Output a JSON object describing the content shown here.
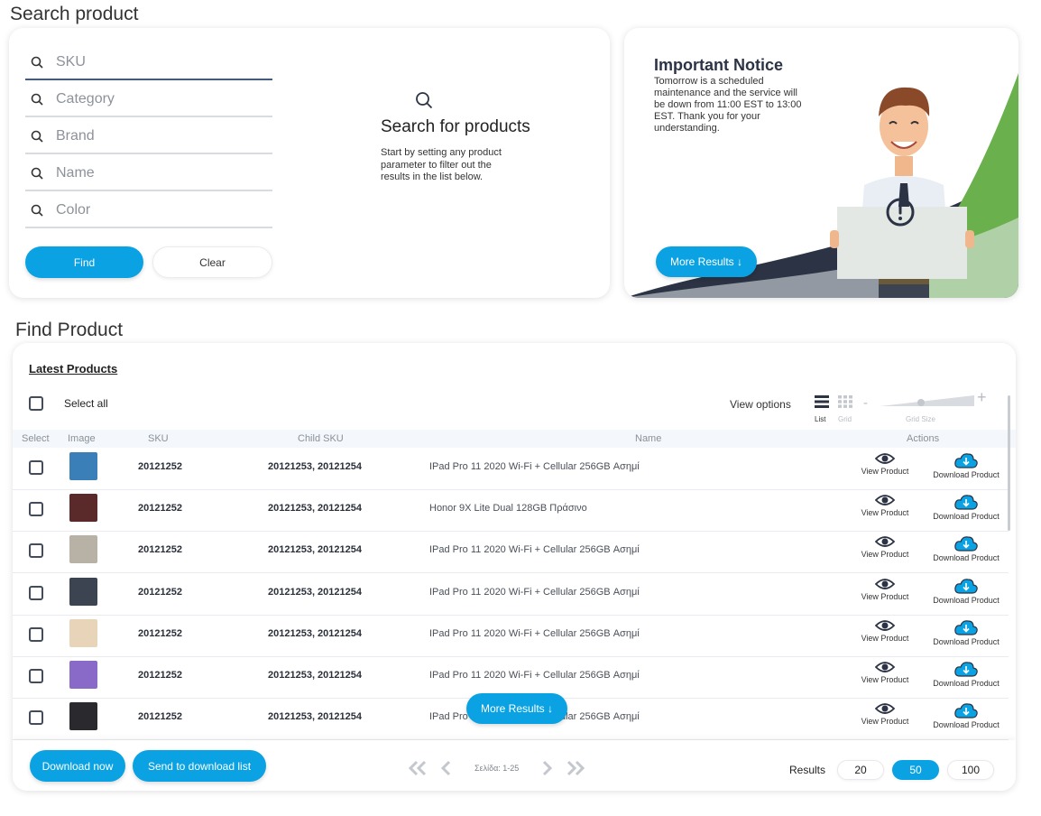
{
  "search_section": {
    "title": "Search product",
    "fields": [
      {
        "placeholder": "SKU",
        "icon": "search-icon"
      },
      {
        "placeholder": "Category",
        "icon": "search-icon"
      },
      {
        "placeholder": "Brand",
        "icon": "search-icon"
      },
      {
        "placeholder": "Name",
        "icon": "search-icon"
      },
      {
        "placeholder": "Color",
        "icon": "search-icon"
      }
    ],
    "find_label": "Find",
    "clear_label": "Clear",
    "empty_title": "Search for products",
    "empty_text": "Start by setting any product parameter to filter out the results in the list below."
  },
  "notice": {
    "title": "Important Notice",
    "text": "Tomorrow is a scheduled maintenance and the service will be down from 11:00 EST to 13:00 EST. Thank you for your understanding.",
    "button_label": "More Results ↓"
  },
  "find_section": {
    "title": "Find Product",
    "tab_label": "Latest Products",
    "select_all": "Select all",
    "view_options": "View options",
    "view_list": "List",
    "view_grid": "Grid",
    "grid_size": "Grid Size",
    "grid_minus": "-",
    "grid_plus": "+",
    "columns": [
      "Select",
      "Image",
      "SKU",
      "Child SKU",
      "Name",
      "Actions"
    ],
    "rows": [
      {
        "sku": "20121252",
        "child_sku": "20121253, 20121254",
        "name": "IPad Pro 11 2020 Wi-Fi + Cellular 256GB Ασημί",
        "thumb_color": "#3a7fb8"
      },
      {
        "sku": "20121252",
        "child_sku": "20121253, 20121254",
        "name": "Honor 9X Lite Dual 128GB Πράσινο",
        "thumb_color": "#5a2a2a"
      },
      {
        "sku": "20121252",
        "child_sku": "20121253, 20121254",
        "name": "IPad Pro 11 2020 Wi-Fi + Cellular 256GB Ασημί",
        "thumb_color": "#b8b2a6"
      },
      {
        "sku": "20121252",
        "child_sku": "20121253, 20121254",
        "name": "IPad Pro 11 2020 Wi-Fi + Cellular 256GB Ασημί",
        "thumb_color": "#3c4452"
      },
      {
        "sku": "20121252",
        "child_sku": "20121253, 20121254",
        "name": "IPad Pro 11 2020 Wi-Fi + Cellular 256GB Ασημί",
        "thumb_color": "#e8d4b8"
      },
      {
        "sku": "20121252",
        "child_sku": "20121253, 20121254",
        "name": "IPad Pro 11 2020 Wi-Fi + Cellular 256GB Ασημί",
        "thumb_color": "#8a6ac8"
      },
      {
        "sku": "20121252",
        "child_sku": "20121253, 20121254",
        "name": "IPad Pro 11 2020 Wi-Fi + Cellular 256GB Ασημί",
        "thumb_color": "#2a2a2e"
      }
    ],
    "view_product_label": "View Product",
    "download_product_label": "Download Product",
    "more_results": "More Results ↓",
    "download_now": "Download now",
    "send_to_list": "Send to download list",
    "page_text": "Σελίδα: 1-25",
    "results_label": "Results",
    "page_sizes": [
      "20",
      "50",
      "100"
    ],
    "selected_page_size": "50"
  },
  "colors": {
    "accent": "#0aa2e2",
    "navy": "#2b3344",
    "green": "#6ab04c"
  }
}
